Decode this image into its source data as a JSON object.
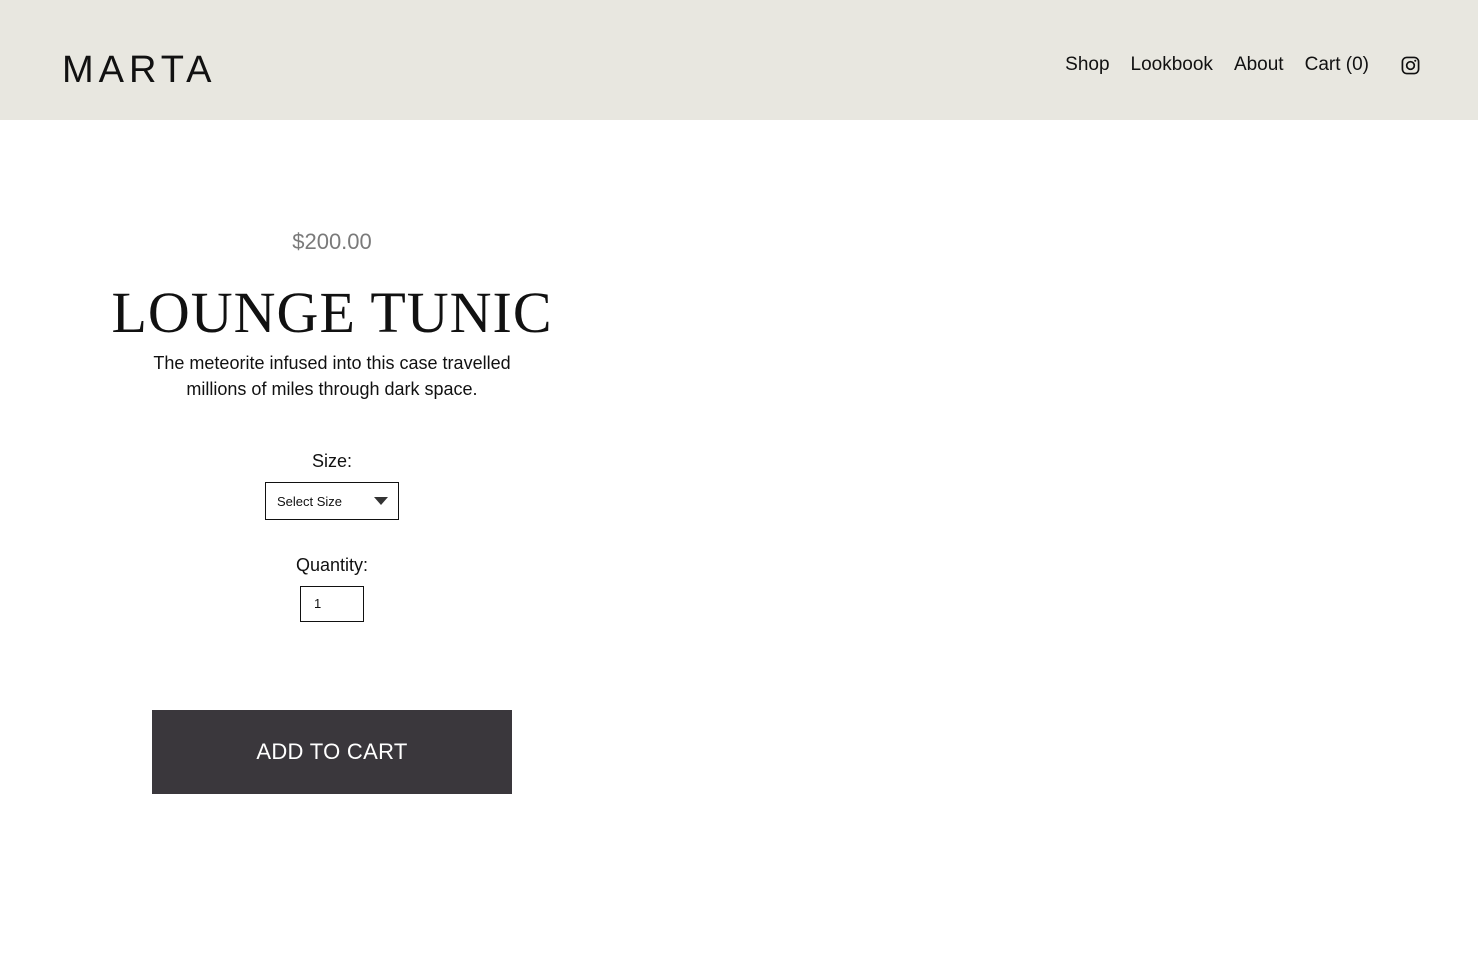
{
  "header": {
    "logo": "MARTA",
    "nav": [
      {
        "label": "Shop"
      },
      {
        "label": "Lookbook"
      },
      {
        "label": "About"
      },
      {
        "label": "Cart (0)"
      }
    ],
    "social_icon": "instagram-icon",
    "background_color": "#e8e7e0"
  },
  "product": {
    "price": "$200.00",
    "title": "LOUNGE TUNIC",
    "description": "The meteorite infused into this case travelled millions of miles through dark space.",
    "size_label": "Size:",
    "size_select_value": "Select Size",
    "quantity_label": "Quantity:",
    "quantity_value": "1",
    "add_to_cart_label": "ADD TO CART",
    "button_color": "#3a373c"
  }
}
